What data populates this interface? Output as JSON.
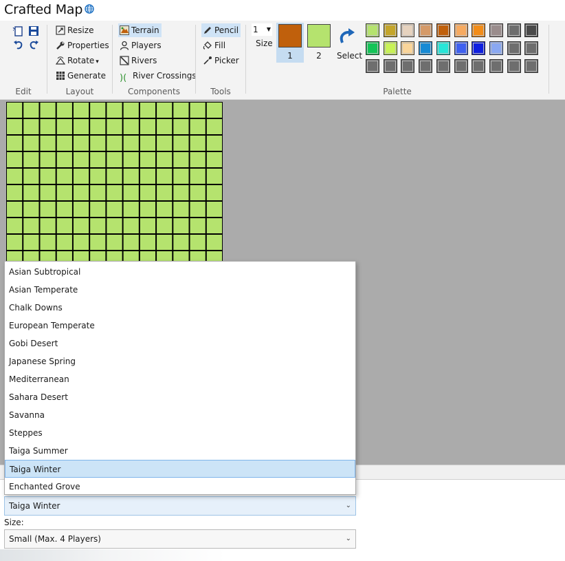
{
  "app": {
    "title": "Crafted Map"
  },
  "ribbon": {
    "edit": {
      "label": "Edit"
    },
    "layout": {
      "label": "Layout",
      "items": [
        {
          "label": "Resize"
        },
        {
          "label": "Properties"
        },
        {
          "label": "Rotate"
        },
        {
          "label": "Generate"
        }
      ]
    },
    "components": {
      "label": "Components",
      "items": [
        {
          "label": "Terrain"
        },
        {
          "label": "Players"
        },
        {
          "label": "Rivers"
        },
        {
          "label": "River Crossings"
        }
      ]
    },
    "tools": {
      "label": "Tools",
      "items": [
        {
          "label": "Pencil"
        },
        {
          "label": "Fill"
        },
        {
          "label": "Picker"
        }
      ]
    },
    "palette": {
      "label": "Palette",
      "size_value": "1",
      "size_label": "Size",
      "swatch1_label": "1",
      "swatch2_label": "2",
      "select_label": "Select",
      "colors": {
        "primary": "#c0600c",
        "secondary": "#b5e36e",
        "grid_fill": "#b5e36e",
        "row1": [
          "#b5e36e",
          "#c4a52a",
          "#e6d2be",
          "#d59a68",
          "#c0600c",
          "#f7aa60",
          "#f28c18",
          "#9a8c8c",
          "#6e6e6e",
          "#4a4a4a"
        ],
        "row2": [
          "#13c457",
          "#c8f256",
          "#fad59a",
          "#178ad4",
          "#27e6d8",
          "#3f60f0",
          "#0f1fe0",
          "#8aa8f2",
          "#6e6e6e",
          "#6e6e6e"
        ],
        "row3": [
          "#6e6e6e",
          "#6e6e6e",
          "#6e6e6e",
          "#6e6e6e",
          "#6e6e6e",
          "#6e6e6e",
          "#6e6e6e",
          "#6e6e6e",
          "#6e6e6e",
          "#6e6e6e"
        ]
      }
    }
  },
  "theme_dropdown": {
    "options": [
      "Asian Subtropical",
      "Asian Temperate",
      "Chalk Downs",
      "European Temperate",
      "Gobi Desert",
      "Japanese Spring",
      "Mediterranean",
      "Sahara Desert",
      "Savanna",
      "Steppes",
      "Taiga Summer",
      "Taiga Winter",
      "Enchanted Grove"
    ],
    "selected": "Taiga Winter"
  },
  "size_field": {
    "label": "Size:",
    "selected": "Small (Max. 4 Players)"
  }
}
